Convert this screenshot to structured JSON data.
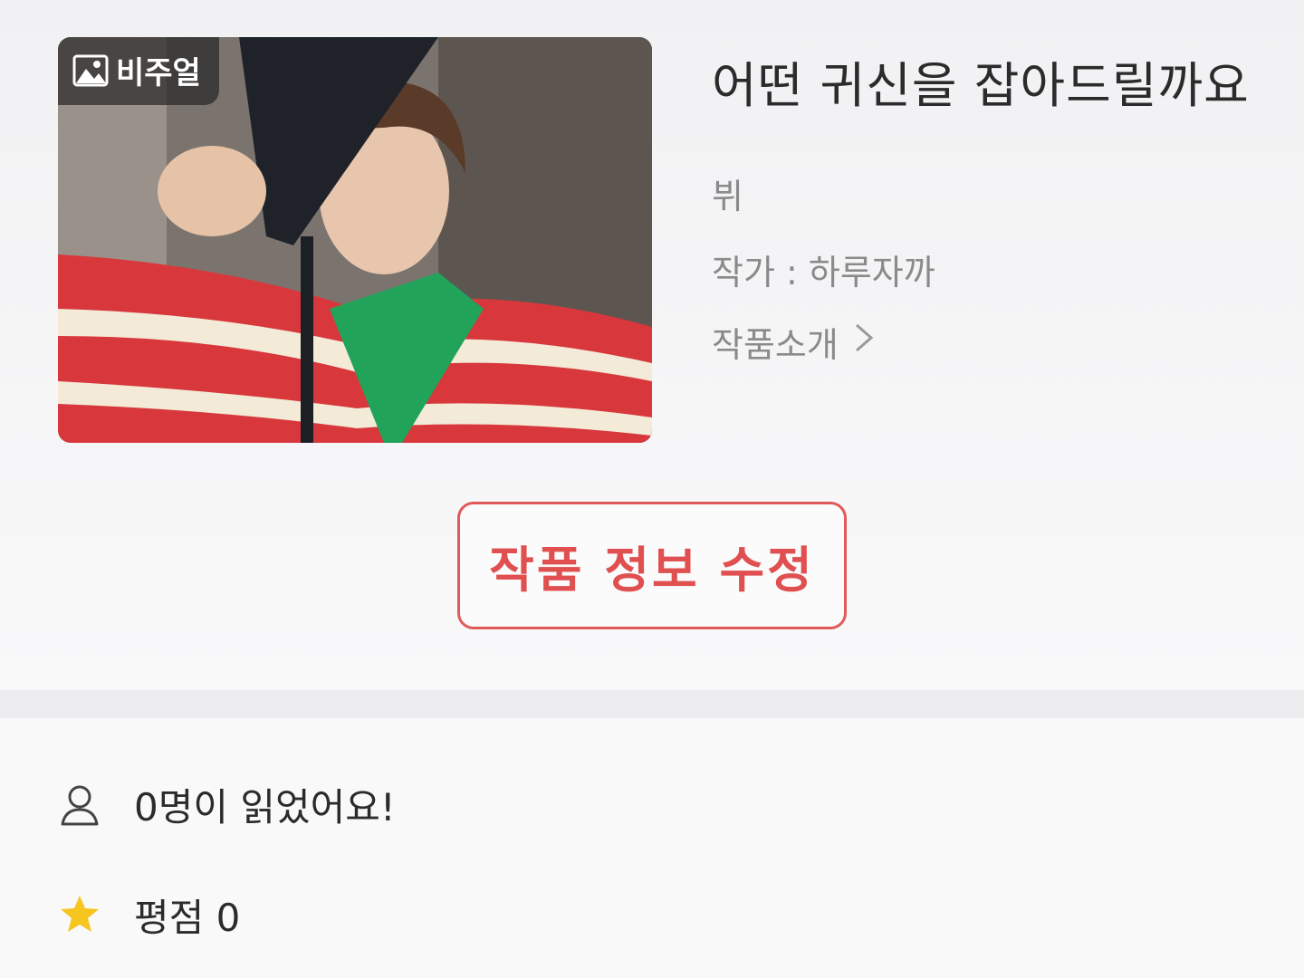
{
  "work": {
    "badge_label": "비주얼",
    "badge_icon": "image-icon",
    "title": "어떤 귀신을 잡아드릴까요",
    "genre": "뷔",
    "author_line": "작가 : 하루자까",
    "intro_label": "작품소개",
    "intro_icon": "chevron-right-icon"
  },
  "actions": {
    "edit_label": "작품 정보 수정",
    "edit_color": "#e05a5a"
  },
  "stats": {
    "reads_icon": "person-icon",
    "reads_text": "0명이 읽었어요!",
    "rating_icon": "star-icon",
    "rating_text": "평점 0",
    "star_color": "#f7c520"
  }
}
